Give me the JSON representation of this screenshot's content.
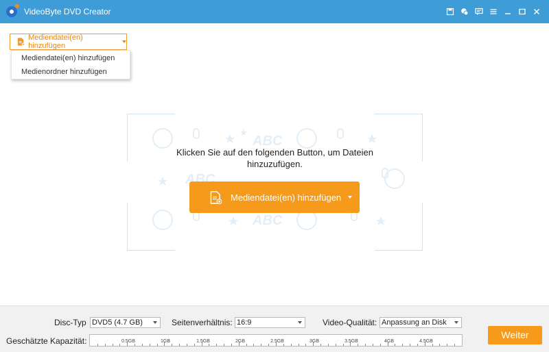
{
  "window": {
    "title": "VideoByte DVD Creator",
    "controls": [
      "save-icon",
      "shop-icon",
      "feedback-icon",
      "menu-icon",
      "minimize-icon",
      "maximize-icon",
      "close-icon"
    ]
  },
  "top_add": {
    "label": "Mediendatei(en) hinzufügen",
    "menu": [
      "Mediendatei(en) hinzufügen",
      "Medienordner hinzufügen"
    ]
  },
  "dropzone": {
    "line1": "Klicken Sie auf den folgenden Button, um Dateien",
    "line2": "hinzuzufügen.",
    "button_label": "Mediendatei(en) hinzufügen",
    "pattern_text": "ABC"
  },
  "bottom": {
    "disc_type_label": "Disc-Typ",
    "disc_type_value": "DVD5 (4.7 GB)",
    "aspect_label": "Seitenverhältnis:",
    "aspect_value": "16:9",
    "quality_label": "Video-Qualität:",
    "quality_value": "Anpassung an Disk",
    "capacity_label": "Geschätzte Kapazität:",
    "capacity_ticks": [
      "0.5GB",
      "1GB",
      "1.5GB",
      "2GB",
      "2.5GB",
      "3GB",
      "3.5GB",
      "4GB",
      "4.5GB"
    ],
    "capacity_max_gb": 5,
    "next_label": "Weiter"
  },
  "colors": {
    "titlebar": "#3e9dd6",
    "accent": "#f59a1a"
  }
}
